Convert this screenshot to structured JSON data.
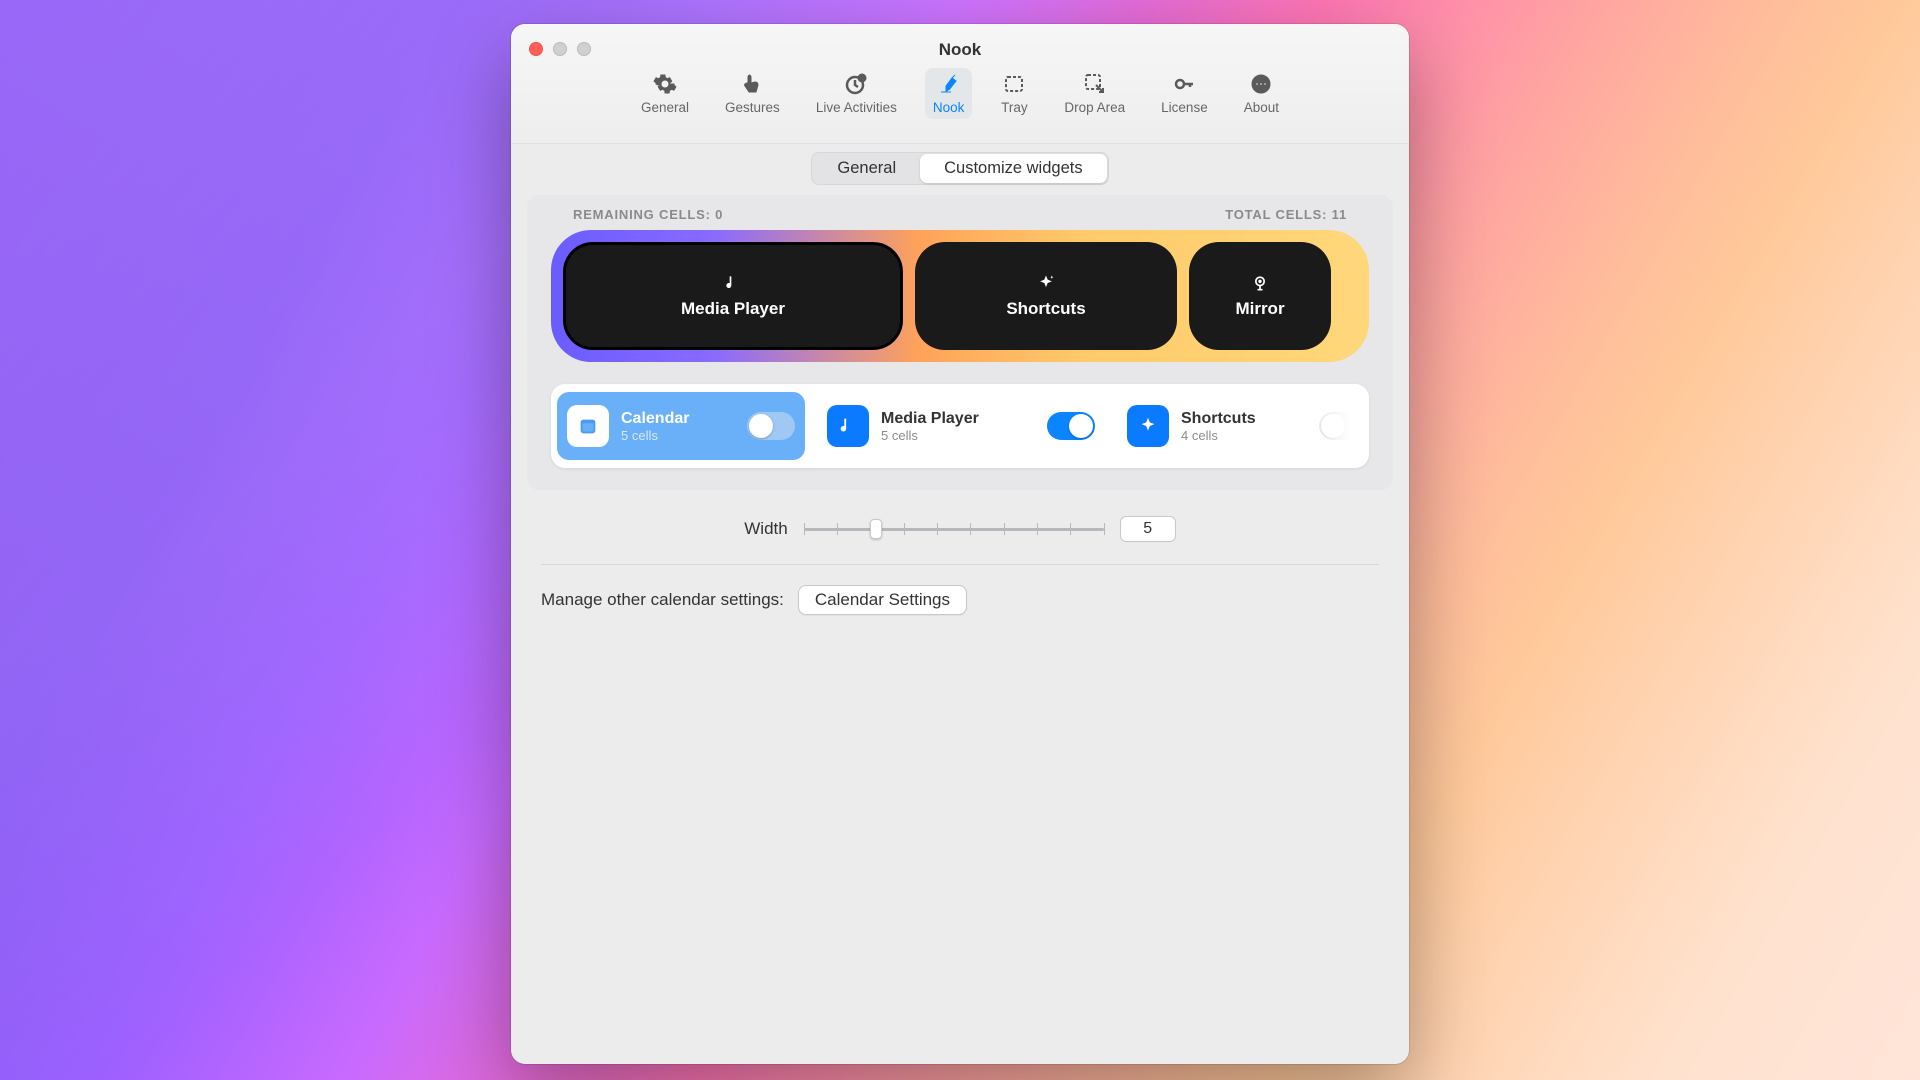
{
  "window": {
    "title": "Nook"
  },
  "toolbar": {
    "items": [
      {
        "label": "General"
      },
      {
        "label": "Gestures"
      },
      {
        "label": "Live Activities"
      },
      {
        "label": "Nook"
      },
      {
        "label": "Tray"
      },
      {
        "label": "Drop Area"
      },
      {
        "label": "License"
      },
      {
        "label": "About"
      }
    ],
    "active_index": 3
  },
  "segmented": {
    "options": [
      "General",
      "Customize widgets"
    ],
    "active_index": 1
  },
  "cells": {
    "remaining_label": "REMAINING CELLS: 0",
    "total_label": "TOTAL CELLS: 11"
  },
  "pill": {
    "items": [
      {
        "title": "Media Player",
        "icon": "music"
      },
      {
        "title": "Shortcuts",
        "icon": "sparkle"
      },
      {
        "title": "Mirror",
        "icon": "camera"
      }
    ]
  },
  "widgets": [
    {
      "name": "Calendar",
      "sub": "5 cells",
      "icon": "calendar",
      "selected": true,
      "enabled": false
    },
    {
      "name": "Media Player",
      "sub": "5 cells",
      "icon": "music",
      "selected": false,
      "enabled": true
    },
    {
      "name": "Shortcuts",
      "sub": "4 cells",
      "icon": "sparkle",
      "selected": false,
      "enabled": true
    }
  ],
  "width": {
    "label": "Width",
    "value": "5",
    "min": 2,
    "max": 11,
    "thumb_pct": 22
  },
  "manage": {
    "label": "Manage other calendar settings:",
    "button": "Calendar Settings"
  }
}
